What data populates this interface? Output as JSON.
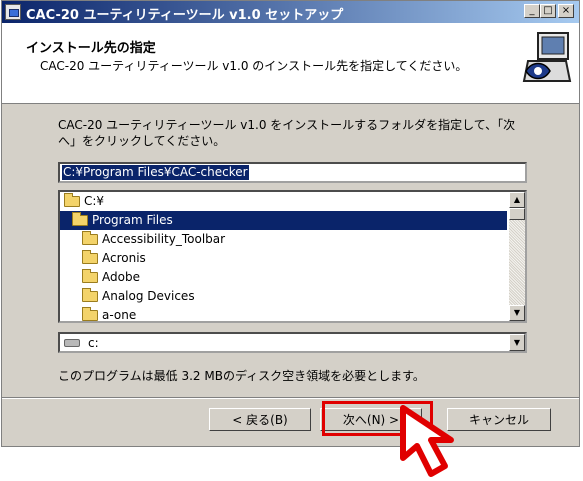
{
  "window": {
    "title": "CAC-20 ユーティリティーツール v1.0 セットアップ",
    "controls": {
      "minimize": "_",
      "maximize": "□",
      "close": "×"
    }
  },
  "header": {
    "title": "インストール先の指定",
    "subtitle": "CAC-20 ユーティリティーツール v1.0 のインストール先を指定してください。"
  },
  "description": "CAC-20 ユーティリティーツール v1.0 をインストールするフォルダを指定して、「次へ」をクリックしてください。",
  "path_input": {
    "value": "C:¥Program Files¥CAC-checker"
  },
  "folder_list": {
    "items": [
      {
        "label": "C:¥",
        "indent": 0,
        "selected": false
      },
      {
        "label": "Program Files",
        "indent": 0,
        "selected": true
      },
      {
        "label": "Accessibility_Toolbar",
        "indent": 1,
        "selected": false
      },
      {
        "label": "Acronis",
        "indent": 1,
        "selected": false
      },
      {
        "label": "Adobe",
        "indent": 1,
        "selected": false
      },
      {
        "label": "Analog Devices",
        "indent": 1,
        "selected": false
      },
      {
        "label": "a-one",
        "indent": 1,
        "selected": false
      }
    ]
  },
  "drive_select": {
    "value": "c:"
  },
  "disk_space_text": "このプログラムは最低 3.2 MBのディスク空き領域を必要とします。",
  "buttons": {
    "back": "< 戻る(B)",
    "next": "次へ(N) >",
    "cancel": "キャンセル"
  },
  "colors": {
    "titlebar": "#0a246a",
    "selection": "#0a246a",
    "highlight": "#e00000"
  }
}
